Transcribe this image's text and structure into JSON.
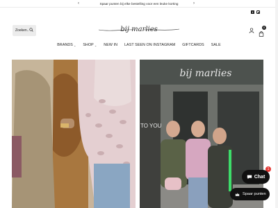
{
  "announcement": {
    "text": "Spaar punten bij elke bestelling voor een leuke korting",
    "prev_arrow": "‹",
    "next_arrow": "›"
  },
  "social": {
    "facebook_glyph": "f",
    "icons": [
      "facebook-icon",
      "instagram-icon"
    ]
  },
  "header": {
    "search_placeholder": "Zoeken..",
    "logo_text": "bij marlies",
    "cart_count": "0"
  },
  "nav": {
    "items": [
      {
        "label": "BRANDS",
        "dropdown": "⌄"
      },
      {
        "label": "SHOP",
        "dropdown": "⌄"
      },
      {
        "label": "NEW IN"
      },
      {
        "label": "LAST SEEN ON INSTAGRAM"
      },
      {
        "label": "GIFTCARDS"
      },
      {
        "label": "SALE"
      }
    ]
  },
  "hero": {
    "right_store_sign": "bij marlies",
    "right_window_text": "TO YOU"
  },
  "widgets": {
    "chat_label": "Chat",
    "chat_badge": "1",
    "points_label": "Spaar punten"
  },
  "colors": {
    "accent_dark": "#111111",
    "badge_red": "#e53935",
    "search_bg": "#ececec"
  }
}
